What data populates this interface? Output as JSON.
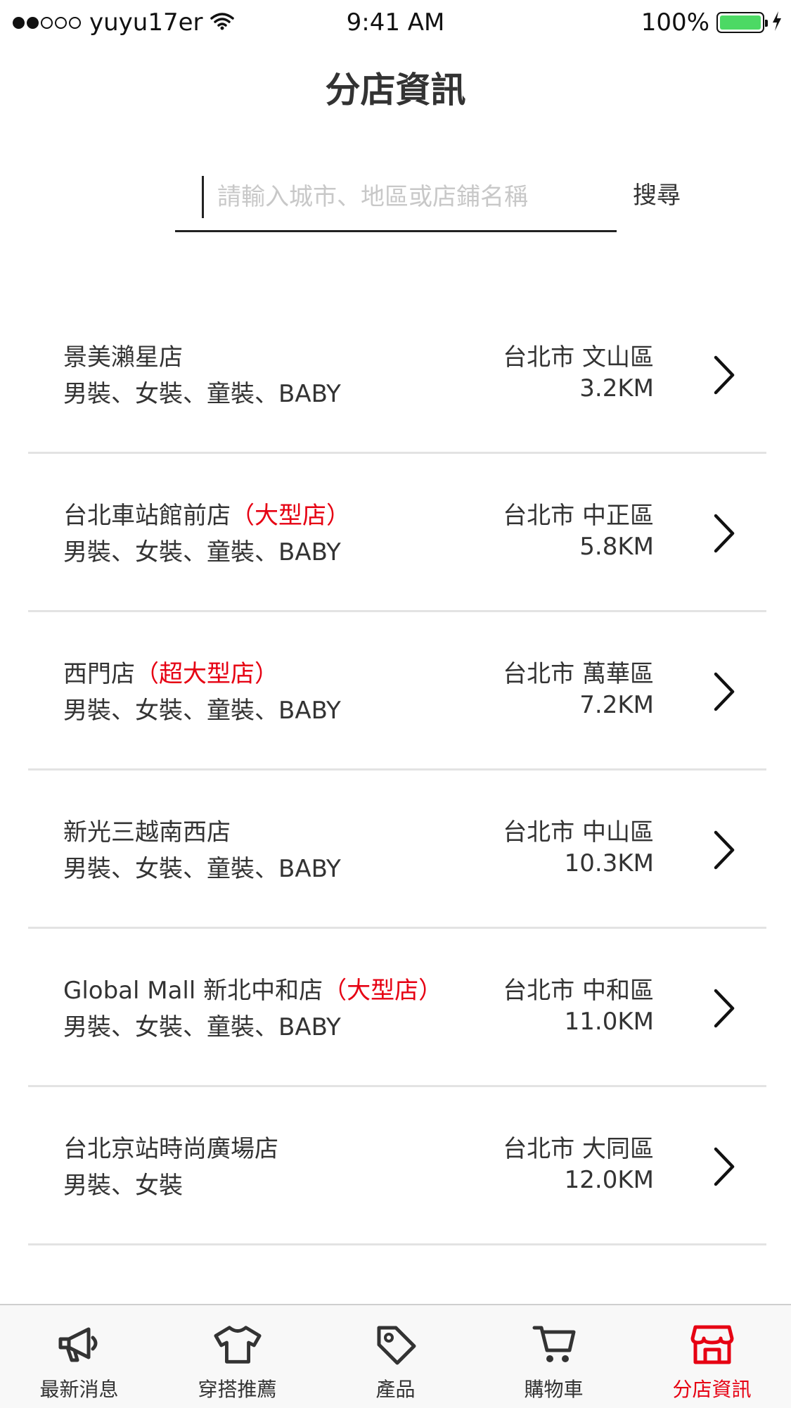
{
  "status_bar": {
    "carrier": "yuyu17er",
    "time": "9:41 AM",
    "battery": "100%",
    "battery_level": 1.0,
    "signal_bars": 2,
    "signal_total": 5
  },
  "header": {
    "title": "分店資訊"
  },
  "search": {
    "value": "",
    "placeholder": "請輸入城市、地區或店鋪名稱",
    "button_label": "搜尋"
  },
  "stores": [
    {
      "name": "景美瀨星店",
      "tag": "",
      "categories": "男裝、女裝、童裝、BABY",
      "location": "台北市 文山區",
      "distance": "3.2KM"
    },
    {
      "name": "台北車站館前店",
      "tag": "（大型店）",
      "categories": "男裝、女裝、童裝、BABY",
      "location": "台北市 中正區",
      "distance": "5.8KM"
    },
    {
      "name": "西門店",
      "tag": "（超大型店）",
      "categories": "男裝、女裝、童裝、BABY",
      "location": "台北市 萬華區",
      "distance": "7.2KM"
    },
    {
      "name": "新光三越南西店",
      "tag": "",
      "categories": "男裝、女裝、童裝、BABY",
      "location": "台北市 中山區",
      "distance": "10.3KM"
    },
    {
      "name": "Global Mall  新北中和店",
      "tag": "（大型店）",
      "categories": "男裝、女裝、童裝、BABY",
      "location": "台北市 中和區",
      "distance": "11.0KM"
    },
    {
      "name": "台北京站時尚廣場店",
      "tag": "",
      "categories": "男裝、女裝",
      "location": "台北市 大同區",
      "distance": "12.0KM"
    }
  ],
  "tab_bar": {
    "active_index": 4,
    "tabs": [
      {
        "label": "最新消息",
        "icon": "megaphone-icon"
      },
      {
        "label": "穿搭推薦",
        "icon": "tshirt-icon"
      },
      {
        "label": "產品",
        "icon": "tag-icon"
      },
      {
        "label": "購物車",
        "icon": "cart-icon"
      },
      {
        "label": "分店資訊",
        "icon": "store-icon"
      }
    ]
  },
  "colors": {
    "accent": "#e60012",
    "text": "#333333",
    "divider": "#e3e3e3",
    "battery": "#4cd964"
  }
}
